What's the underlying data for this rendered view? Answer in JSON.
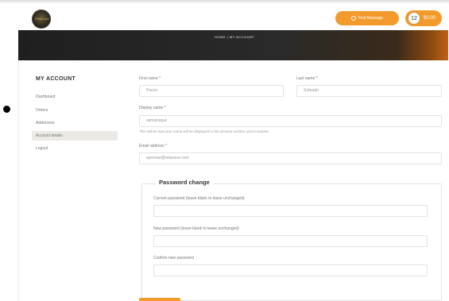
{
  "header": {
    "logo_text": "Relax Ave",
    "find_button_label": "Find Massage",
    "cart_count": "12",
    "cart_total": "$0.00"
  },
  "banner": {
    "breadcrumb": "HOME  |  MY ACCOUNT"
  },
  "sidebar": {
    "title": "MY ACCOUNT",
    "items": [
      {
        "label": "Dashboard"
      },
      {
        "label": "Orders"
      },
      {
        "label": "Addresses"
      },
      {
        "label": "Account details"
      },
      {
        "label": "Logout"
      }
    ]
  },
  "form": {
    "first_name_label": "First name *",
    "first_name_value": "Parcio",
    "last_name_label": "Last name *",
    "last_name_value": "Sobrado",
    "display_name_label": "Display name *",
    "display_name_value": "samsiraque",
    "display_name_hint": "This will be how your name will be displayed in the account section and in reviews",
    "email_label": "Email address *",
    "email_value": "ayesirae@relaxave.com",
    "password_section_title": "Password change",
    "current_password_label": "Current password (leave blank to leave unchanged)",
    "new_password_label": "New password (leave blank to leave unchanged)",
    "confirm_password_label": "Confirm new password"
  },
  "colors": {
    "accent": "#f39a2d",
    "banner": "#222222"
  }
}
